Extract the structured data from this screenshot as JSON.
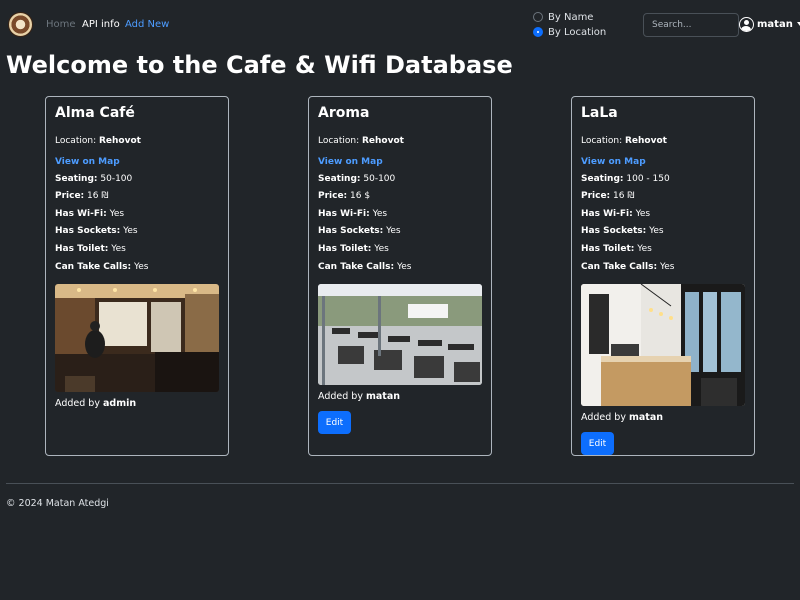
{
  "nav": {
    "home": "Home",
    "api_info": "API info",
    "add_new": "Add New"
  },
  "sort": {
    "by_name": "By Name",
    "by_location": "By Location",
    "selected": "by_location"
  },
  "search": {
    "placeholder": "Search..."
  },
  "user": {
    "name": "matan"
  },
  "page_title": "Welcome to the Cafe & Wifi Database",
  "labels": {
    "location": "Location:",
    "view_on_map": "View on Map",
    "seating": "Seating:",
    "price": "Price:",
    "has_wifi": "Has Wi-Fi:",
    "has_sockets": "Has Sockets:",
    "has_toilet": "Has Toilet:",
    "can_take_calls": "Can Take Calls:",
    "added_by": "Added by",
    "edit": "Edit"
  },
  "cafes": [
    {
      "name": "Alma Café",
      "location": "Rehovot",
      "seating": "50-100",
      "price": "16 ₪",
      "has_wifi": "Yes",
      "has_sockets": "Yes",
      "has_toilet": "Yes",
      "can_take_calls": "Yes",
      "added_by": "admin"
    },
    {
      "name": "Aroma",
      "location": "Rehovot",
      "seating": "50-100",
      "price": "16 $",
      "has_wifi": "Yes",
      "has_sockets": "Yes",
      "has_toilet": "Yes",
      "can_take_calls": "Yes",
      "added_by": "matan"
    },
    {
      "name": "LaLa",
      "location": "Rehovot",
      "seating": "100 - 150",
      "price": "16 ₪",
      "has_wifi": "Yes",
      "has_sockets": "Yes",
      "has_toilet": "Yes",
      "can_take_calls": "Yes",
      "added_by": "matan"
    }
  ],
  "footer": "© 2024 Matan Atedgi",
  "colors": {
    "background": "#212529",
    "link": "#4d9cff",
    "button": "#0d6efd"
  }
}
